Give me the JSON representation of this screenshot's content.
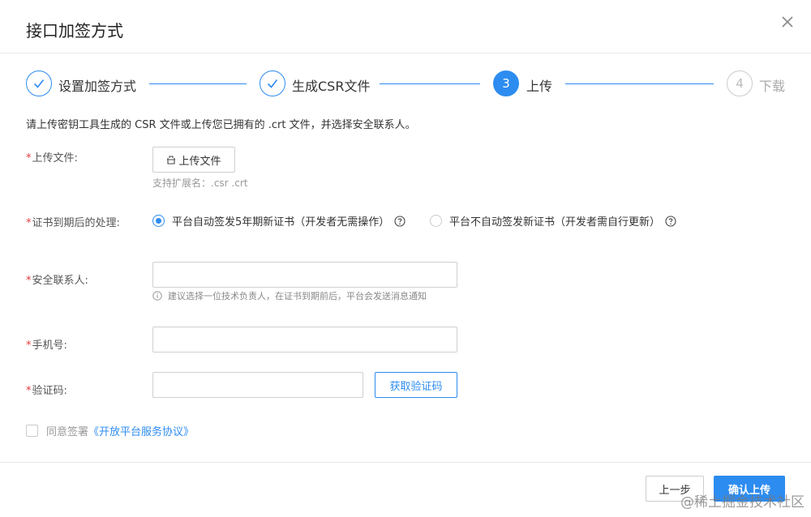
{
  "dialog": {
    "title": "接口加签方式",
    "close_icon": "close-icon"
  },
  "steps": [
    {
      "number": "1",
      "label": "设置加签方式",
      "status": "done"
    },
    {
      "number": "2",
      "label": "生成CSR文件",
      "status": "done"
    },
    {
      "number": "3",
      "label": "上传",
      "status": "active"
    },
    {
      "number": "4",
      "label": "下载",
      "status": "wait"
    }
  ],
  "intro_text": "请上传密钥工具生成的 CSR 文件或上传您已拥有的 .crt 文件，并选择安全联系人。",
  "form": {
    "required_mark": "*",
    "upload": {
      "label": "上传文件:",
      "button_label": "上传文件",
      "hint": "支持扩展名：.csr .crt"
    },
    "expiry": {
      "label": "证书到期后的处理:",
      "options": [
        {
          "label": "平台自动签发5年期新证书（开发者无需操作）",
          "checked": true
        },
        {
          "label": "平台不自动签发新证书（开发者需自行更新）",
          "checked": false
        }
      ]
    },
    "contact": {
      "label": "安全联系人:",
      "value": "",
      "tip": "建议选择一位技术负责人，在证书到期前后，平台会发送消息通知"
    },
    "phone": {
      "label": "手机号:",
      "value": ""
    },
    "code": {
      "label": "验证码:",
      "value": "",
      "button_label": "获取验证码"
    },
    "agreement": {
      "prefix": "同意签署",
      "link": "《开放平台服务协议》",
      "checked": false
    }
  },
  "footer": {
    "prev_label": "上一步",
    "confirm_label": "确认上传"
  },
  "watermark": "@稀土掘金技术社区",
  "colors": {
    "accent": "#2d8cf0",
    "required": "#e4393c"
  }
}
